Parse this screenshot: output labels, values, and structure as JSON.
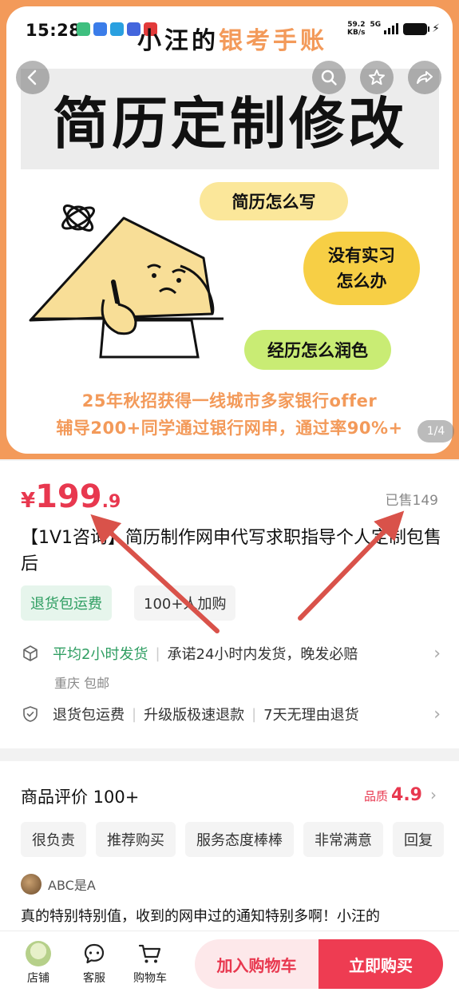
{
  "status_bar": {
    "time": "15:28",
    "net_speed": "59.2",
    "net_unit": "KB/s",
    "network": "5G"
  },
  "watermark": {
    "part1": "小汪的",
    "part2": "银考手账"
  },
  "hero": {
    "title": "简历定制修改",
    "bubbles": [
      "简历怎么写",
      "没有实习\n怎么办",
      "经历怎么润色"
    ],
    "line1": "25年秋招获得一线城市多家银行offer",
    "line2": "辅导200+同学通过银行网申，通过率90%+",
    "page_indicator": "1/4"
  },
  "product": {
    "price_symbol": "¥",
    "price_int": "199",
    "price_dec": ".9",
    "sold": "已售149",
    "title": "【1V1咨询】简历制作网申代写求职指导个人定制包售后",
    "tags": [
      "退货包运费",
      "100+人加购"
    ]
  },
  "shipping": {
    "highlight": "平均2小时发货",
    "promise": "承诺24小时内发货，晚发必赔",
    "origin": "重庆 包邮"
  },
  "service": {
    "items": [
      "退货包运费",
      "升级版极速退款",
      "7天无理由退货"
    ]
  },
  "reviews": {
    "heading": "商品评价 100+",
    "quality_label": "品质",
    "quality_score": "4.9",
    "chips": [
      "很负责",
      "推荐购买",
      "服务态度棒棒",
      "非常满意",
      "回复"
    ],
    "reviewer": "ABC是A",
    "text": "真的特别特别值，收到的网申过的通知特别多啊！小汪的"
  },
  "bottom_bar": {
    "shop": "店铺",
    "service": "客服",
    "cart": "购物车",
    "add_to_cart": "加入购物车",
    "buy_now": "立即购买"
  },
  "colors": {
    "accent_orange": "#f39a5a",
    "price_red": "#e8384f",
    "green": "#2f9e62"
  },
  "icons": [
    "back-icon",
    "search-icon",
    "star-icon",
    "share-icon",
    "ship-icon",
    "shield-check-icon",
    "chevron-right-icon",
    "service-chat-icon",
    "cart-icon",
    "annotation-arrow"
  ]
}
